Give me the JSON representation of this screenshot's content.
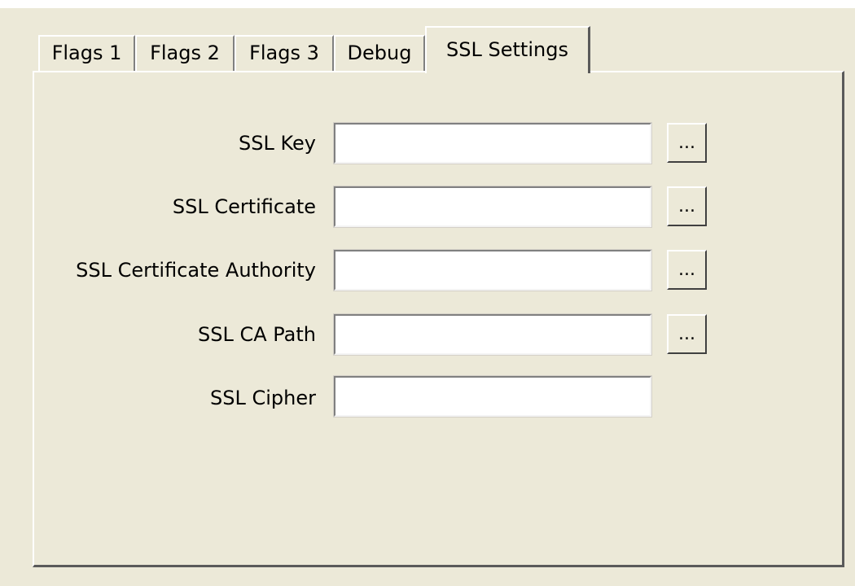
{
  "tabs": [
    {
      "label": "Flags 1",
      "active": false
    },
    {
      "label": "Flags 2",
      "active": false
    },
    {
      "label": "Flags 3",
      "active": false
    },
    {
      "label": "Debug",
      "active": false
    },
    {
      "label": "SSL Settings",
      "active": true
    }
  ],
  "ssl": {
    "key": {
      "label": "SSL Key",
      "value": "",
      "browse_label": "..."
    },
    "certificate": {
      "label": "SSL Certificate",
      "value": "",
      "browse_label": "..."
    },
    "certificate_authority": {
      "label": "SSL Certificate Authority",
      "value": "",
      "browse_label": "..."
    },
    "ca_path": {
      "label": "SSL CA Path",
      "value": "",
      "browse_label": "..."
    },
    "cipher": {
      "label": "SSL Cipher",
      "value": ""
    }
  },
  "colors": {
    "background": "#ece9d8",
    "input_background": "#ffffff",
    "shadow": "#808080"
  }
}
